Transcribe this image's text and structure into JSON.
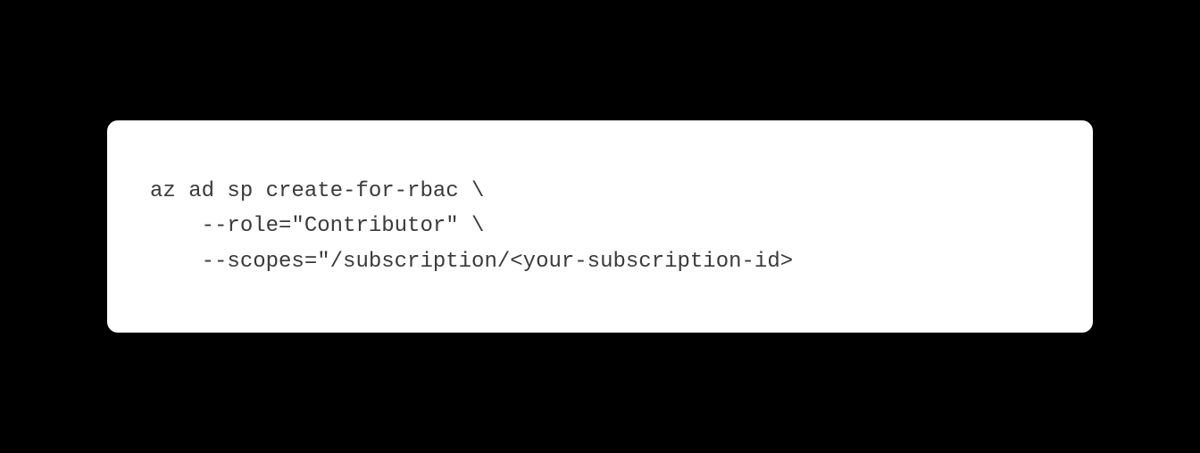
{
  "code": {
    "line1": "az ad sp create-for-rbac \\",
    "line2": "    --role=\"Contributor\" \\",
    "line3": "    --scopes=\"/subscription/<your-subscription-id>"
  }
}
